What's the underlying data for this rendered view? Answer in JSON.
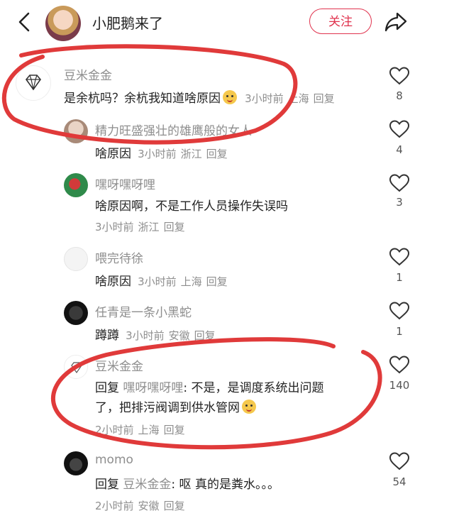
{
  "header": {
    "author_name": "小肥鹅来了",
    "follow_label": "关注"
  },
  "comments": [
    {
      "username": "豆米金金",
      "text": "是余杭吗？余杭我知道啥原因",
      "time": "3小时前",
      "location": "上海",
      "reply_label": "回复",
      "likes": "8"
    },
    {
      "username": "精力旺盛强壮的雄鹰般的女人",
      "text": "啥原因",
      "time": "3小时前",
      "location": "浙江",
      "reply_label": "回复",
      "likes": "4"
    },
    {
      "username": "嘿呀嘿呀哩",
      "text": "啥原因啊，不是工作人员操作失误吗",
      "time": "3小时前",
      "location": "浙江",
      "reply_label": "回复",
      "likes": "3"
    },
    {
      "username": "喂完待徐",
      "text": "啥原因",
      "time": "3小时前",
      "location": "上海",
      "reply_label": "回复",
      "likes": "1"
    },
    {
      "username": "任青是一条小黑蛇",
      "text": "蹲蹲",
      "time": "3小时前",
      "location": "安徽",
      "reply_label": "回复",
      "likes": "1"
    },
    {
      "username": "豆米金金",
      "reply_prefix": "回复",
      "reply_target": "嘿呀嘿呀哩",
      "text_line1": ": 不是，是调度系统出问题",
      "text_line2": "了，把排污阀调到供水管网",
      "time": "2小时前",
      "location": "上海",
      "reply_label": "回复",
      "likes": "140"
    },
    {
      "username": "momo",
      "reply_prefix": "回复",
      "reply_target": "豆米金金",
      "text": ": 呕 真的是粪水。。。",
      "time": "2小时前",
      "location": "安徽",
      "reply_label": "回复",
      "likes": "54"
    }
  ],
  "colors": {
    "accent": "#e0334e",
    "annotation": "#e03a3a",
    "meta": "#8e8e8e"
  },
  "icons": [
    "back-chevron-icon",
    "share-arrow-icon",
    "heart-icon",
    "diamond-icon",
    "emoji-face-icon"
  ]
}
